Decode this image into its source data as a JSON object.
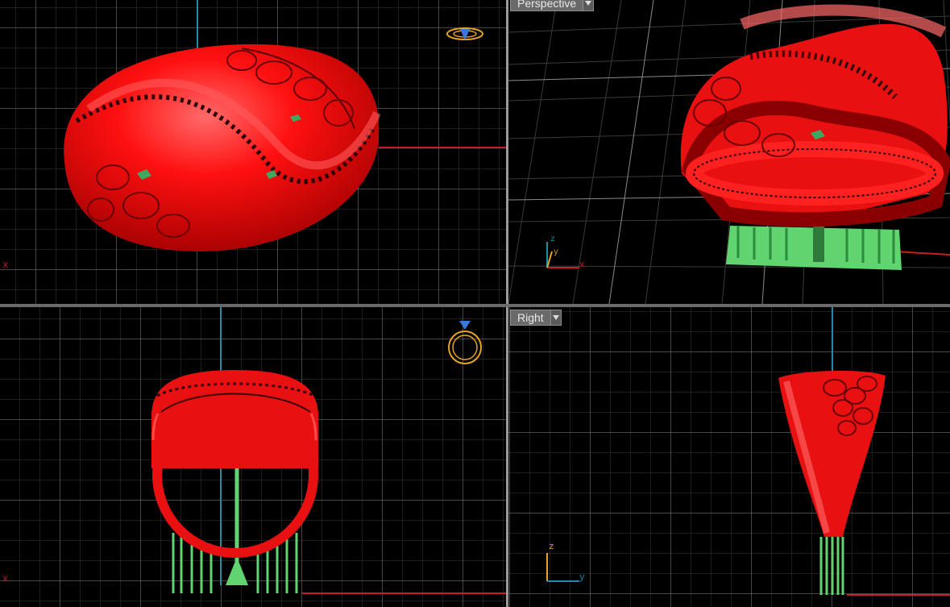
{
  "viewports": {
    "top": {
      "axis_x_label": "x"
    },
    "perspective": {
      "title": "Perspective",
      "axis_x_label": "x",
      "axis_y_label": "y",
      "axis_z_label": "z"
    },
    "front": {
      "axis_x_label": "x"
    },
    "right": {
      "title": "Right",
      "axis_y_label": "y",
      "axis_z_label": "z"
    }
  },
  "colors": {
    "background": "#000000",
    "grid_minor": "#3a3a3a",
    "grid_major": "#8a8a8a",
    "axis_x": "#c81e1e",
    "axis_y": "#1e8fa8",
    "model": "#ff1a1a",
    "supports": "#5fd46f",
    "gizmo": "#e8a521",
    "gem": "#3a7ad6"
  },
  "icons": {
    "ring_gizmo": "ring-gizmo-icon",
    "dropdown": "chevron-down-icon"
  }
}
